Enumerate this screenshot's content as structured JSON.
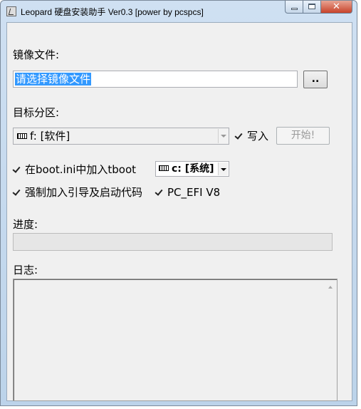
{
  "window": {
    "title": "Leopard 硬盘安装助手 Ver0.3 [power by pcspcs]",
    "close_glyph": "✕"
  },
  "image": {
    "label": "镜像文件:",
    "input_value": "请选择镜像文件",
    "browse_label": ".."
  },
  "partition": {
    "label": "目标分区:",
    "selected": "f: [软件]",
    "write_checkbox_label": "写入",
    "write_checked": true,
    "start_label": "开始!"
  },
  "options": {
    "tboot_label": "在boot.ini中加入tboot",
    "tboot_checked": true,
    "tboot_drive": "c: [系统]",
    "force_boot_label": "强制加入引导及启动代码",
    "force_boot_checked": true,
    "pc_efi_label": "PC_EFI V8",
    "pc_efi_checked": true
  },
  "progress": {
    "label": "进度:",
    "value": 0
  },
  "log": {
    "label": "日志:",
    "content": ""
  },
  "colors": {
    "selection": "#3399ff",
    "selection_text": "#ffffff"
  }
}
